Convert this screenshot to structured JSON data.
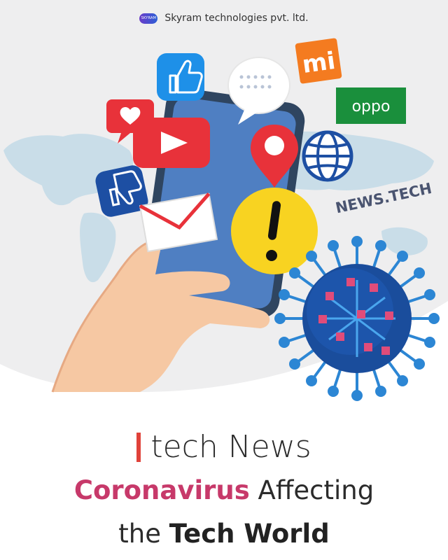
{
  "brand": {
    "logo_text": "SKYRAM",
    "name": "Skyram technologies pvt. ltd."
  },
  "icons": {
    "mi_text": "mi",
    "oppo_text": "oppo",
    "news_label": "NEWS.TECH"
  },
  "headline": {
    "line1": "tech News",
    "line2_accent": "Coronavirus",
    "line2_rest": "Affecting",
    "line3_plain": "the",
    "line3_bold": "Tech World"
  },
  "colors": {
    "accent": "#c7396a",
    "red_bar": "#e0423a",
    "virus": "#1a4d9c"
  }
}
